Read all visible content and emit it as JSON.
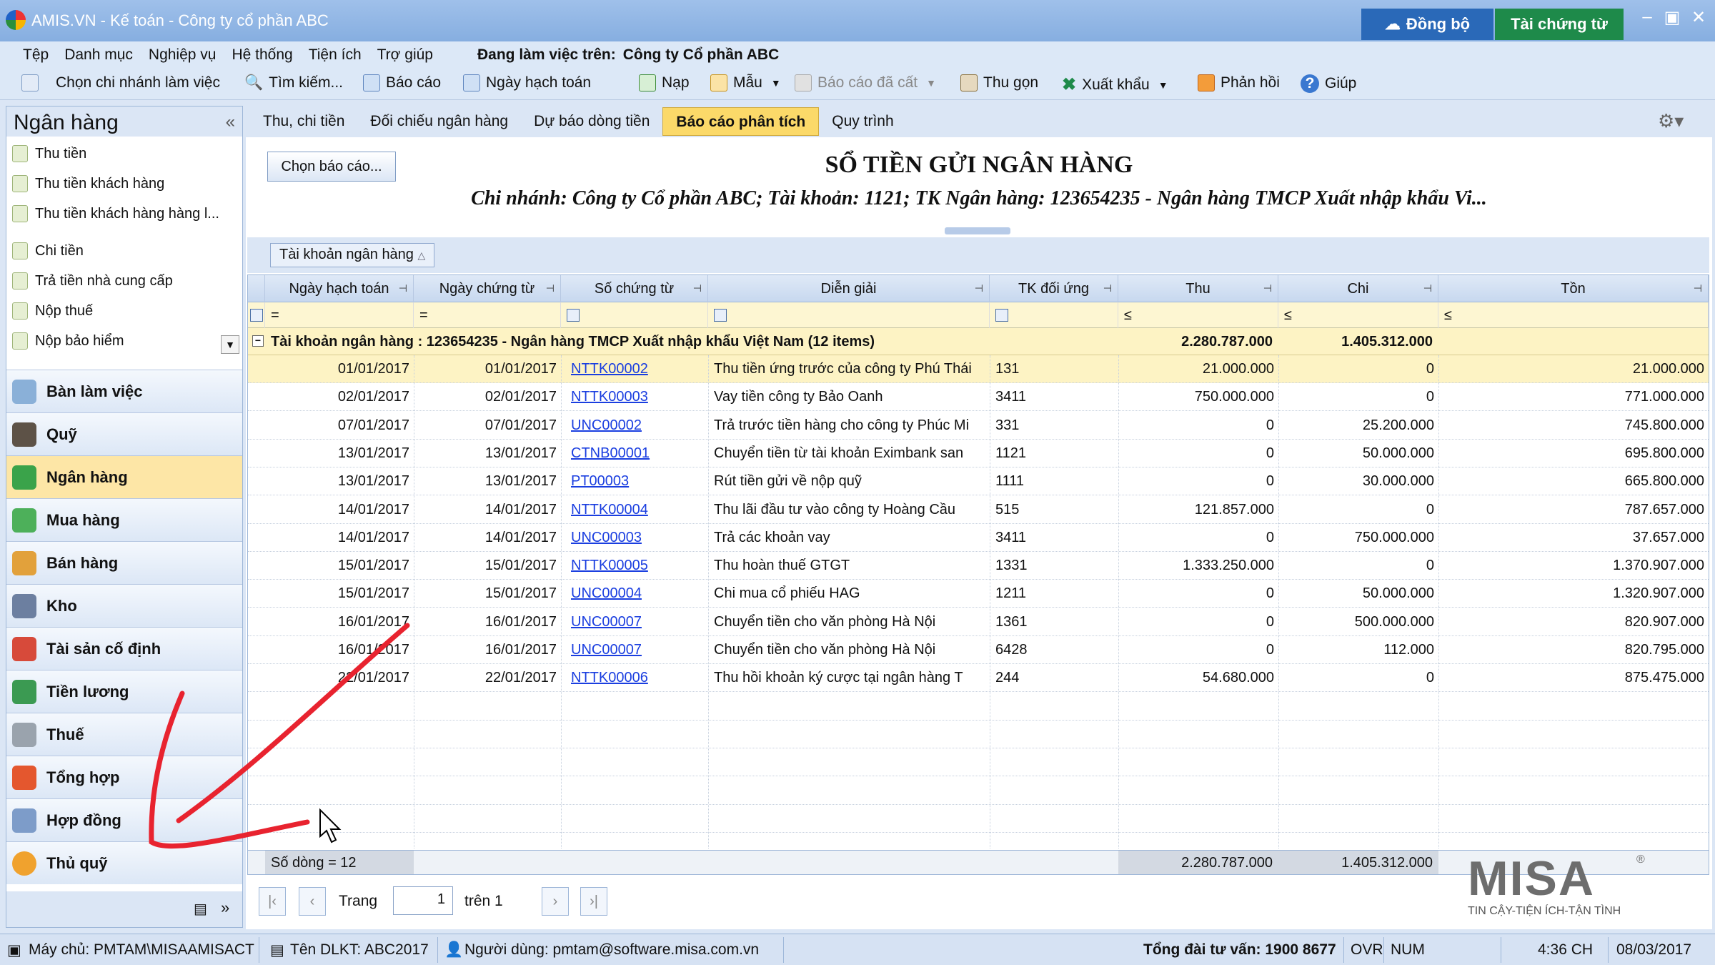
{
  "window": {
    "title": "AMIS.VN - Kế toán - Công ty cổ phần ABC",
    "sync_label": "Đồng bộ",
    "resource_label": "Tài chứng từ"
  },
  "menu": {
    "items": [
      "Tệp",
      "Danh mục",
      "Nghiệp vụ",
      "Hệ thống",
      "Tiện ích",
      "Trợ giúp"
    ],
    "working_label": "Đang làm việc trên:",
    "working_company": "Công ty Cổ phần ABC"
  },
  "toolbar": {
    "branch": "Chọn chi nhánh làm việc",
    "search": "Tìm kiếm...",
    "report": "Báo cáo",
    "posting_date": "Ngày hạch toán",
    "load": "Nạp",
    "template": "Mẫu",
    "saved_report": "Báo cáo đã cất",
    "collapse": "Thu gọn",
    "export": "Xuất khẩu",
    "feedback": "Phản hồi",
    "help": "Giúp"
  },
  "sidebar": {
    "title": "Ngân hàng",
    "sub_items": [
      "Thu tiền",
      "Thu tiền khách hàng",
      "Thu tiền khách hàng hàng l...",
      "Chi tiền",
      "Trả tiền nhà cung cấp",
      "Nộp thuế",
      "Nộp bảo hiểm"
    ],
    "modules": [
      "Bàn làm việc",
      "Quỹ",
      "Ngân hàng",
      "Mua hàng",
      "Bán hàng",
      "Kho",
      "Tài sản cố định",
      "Tiền lương",
      "Thuế",
      "Tổng hợp",
      "Hợp đồng",
      "Thủ quỹ"
    ],
    "selected_module": "Ngân hàng"
  },
  "tabs": [
    "Thu, chi tiền",
    "Đối chiếu ngân hàng",
    "Dự báo dòng tiền",
    "Báo cáo phân tích",
    "Quy trình"
  ],
  "active_tab": "Báo cáo phân tích",
  "report": {
    "choose_label": "Chọn báo cáo...",
    "title": "SỔ TIỀN GỬI NGÂN HÀNG",
    "subtitle": "Chi nhánh: Công ty Cổ phần ABC; Tài khoản: 1121; TK Ngân hàng: 123654235 - Ngân hàng TMCP Xuất nhập khẩu Vi..."
  },
  "grid": {
    "group_chip": "Tài khoản ngân hàng",
    "columns": [
      "Ngày hạch toán",
      "Ngày chứng từ",
      "Số chứng từ",
      "Diễn giải",
      "TK đối ứng",
      "Thu",
      "Chi",
      "Tồn"
    ],
    "filter_ops": [
      "=",
      "=",
      "",
      "",
      "",
      "≤",
      "≤",
      "≤"
    ],
    "group_label": "Tài khoản ngân hàng : 123654235 - Ngân hàng TMCP Xuất nhập khẩu Việt Nam (12 items)",
    "group_thu": "2.280.787.000",
    "group_chi": "1.405.312.000",
    "rows": [
      [
        "01/01/2017",
        "01/01/2017",
        "NTTK00002",
        "Thu tiền ứng trước của công ty Phú Thái",
        "131",
        "21.000.000",
        "0",
        "21.000.000"
      ],
      [
        "02/01/2017",
        "02/01/2017",
        "NTTK00003",
        "Vay tiền công ty Bảo Oanh",
        "3411",
        "750.000.000",
        "0",
        "771.000.000"
      ],
      [
        "07/01/2017",
        "07/01/2017",
        "UNC00002",
        "Trả trước tiền hàng cho công ty Phúc Mi",
        "331",
        "0",
        "25.200.000",
        "745.800.000"
      ],
      [
        "13/01/2017",
        "13/01/2017",
        "CTNB00001",
        "Chuyển tiền từ tài khoản Eximbank san",
        "1121",
        "0",
        "50.000.000",
        "695.800.000"
      ],
      [
        "13/01/2017",
        "13/01/2017",
        "PT00003",
        "Rút tiền gửi về nộp quỹ",
        "1111",
        "0",
        "30.000.000",
        "665.800.000"
      ],
      [
        "14/01/2017",
        "14/01/2017",
        "NTTK00004",
        "Thu lãi đầu tư vào công ty Hoàng Cầu",
        "515",
        "121.857.000",
        "0",
        "787.657.000"
      ],
      [
        "14/01/2017",
        "14/01/2017",
        "UNC00003",
        "Trả các khoản vay",
        "3411",
        "0",
        "750.000.000",
        "37.657.000"
      ],
      [
        "15/01/2017",
        "15/01/2017",
        "NTTK00005",
        "Thu hoàn thuế GTGT",
        "1331",
        "1.333.250.000",
        "0",
        "1.370.907.000"
      ],
      [
        "15/01/2017",
        "15/01/2017",
        "UNC00004",
        "Chi mua cổ phiếu HAG",
        "1211",
        "0",
        "50.000.000",
        "1.320.907.000"
      ],
      [
        "16/01/2017",
        "16/01/2017",
        "UNC00007",
        "Chuyển tiền cho văn phòng Hà Nội",
        "1361",
        "0",
        "500.000.000",
        "820.907.000"
      ],
      [
        "16/01/2017",
        "16/01/2017",
        "UNC00007",
        "Chuyển tiền cho văn phòng Hà Nội",
        "6428",
        "0",
        "112.000",
        "820.795.000"
      ],
      [
        "22/01/2017",
        "22/01/2017",
        "NTTK00006",
        "Thu hồi khoản ký cược tại ngân hàng T",
        "244",
        "54.680.000",
        "0",
        "875.475.000"
      ]
    ],
    "footer_count": "Số dòng = 12",
    "footer_thu": "2.280.787.000",
    "footer_chi": "1.405.312.000"
  },
  "pager": {
    "page_label": "Trang",
    "page_value": "1",
    "of_label": "trên 1"
  },
  "brand": {
    "name": "MISA",
    "tagline": "TIN CẬY-TIỆN ÍCH-TẬN TÌNH",
    "registered": "®"
  },
  "status": {
    "server": "Máy chủ: PMTAM\\MISAAMISACT",
    "db": "Tên DLKT: ABC2017",
    "user": "Người dùng: pmtam@software.misa.com.vn",
    "hotline": "Tổng đài tư vấn: 1900 8677",
    "ovr": "OVR",
    "num": "NUM",
    "time": "4:36 CH",
    "date": "08/03/2017"
  },
  "colors": {
    "selected_tab": "#fbd969",
    "selected_row": "#fdf3c4",
    "link": "#1a3ee0",
    "annotation": "#e8232f"
  }
}
